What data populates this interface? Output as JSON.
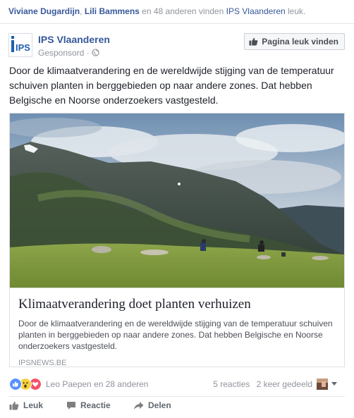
{
  "social_context": {
    "friend1": "Viviane Dugardijn",
    "separator": ", ",
    "friend2": "Lili Bammens",
    "middle": " en 48 anderen vinden ",
    "page": "IPS Vlaanderen",
    "suffix": " leuk."
  },
  "post_header": {
    "logo_text": "IPS",
    "page_name": "IPS Vlaanderen",
    "sponsored": "Gesponsord",
    "dot": "·",
    "like_page_button": "Pagina leuk vinden"
  },
  "post_text": "Door de klimaatverandering en de wereldwijde stijging van de temperatuur schuiven planten in berggebieden op naar andere zones. Dat hebben Belgische en Noorse onderzoekers vastgesteld.",
  "link_card": {
    "title": "Klimaatverandering doet planten verhuizen",
    "description": "Door de klimaatverandering en de wereldwijde stijging van de temperatuur schuiven planten in berggebieden op naar andere zones. Dat hebben Belgische en Noorse onderzoekers vastgesteld.",
    "domain": "IPSNEWS.BE"
  },
  "reactions": {
    "names": "Leo Paepen en 28 anderen",
    "comments": "5 reacties",
    "shares": "2 keer gedeeld"
  },
  "actions": {
    "like": "Leuk",
    "comment": "Reactie",
    "share": "Delen"
  },
  "colors": {
    "link": "#365899",
    "meta": "#90949c",
    "like_blue": "#5890ff",
    "love_red": "#f25268",
    "wow_yellow": "#f7d23e"
  },
  "icons": [
    "globe-icon",
    "thumbs-up-icon",
    "like-reaction-icon",
    "wow-reaction-icon",
    "love-reaction-icon",
    "comment-icon",
    "share-arrow-icon",
    "chevron-down-icon"
  ]
}
